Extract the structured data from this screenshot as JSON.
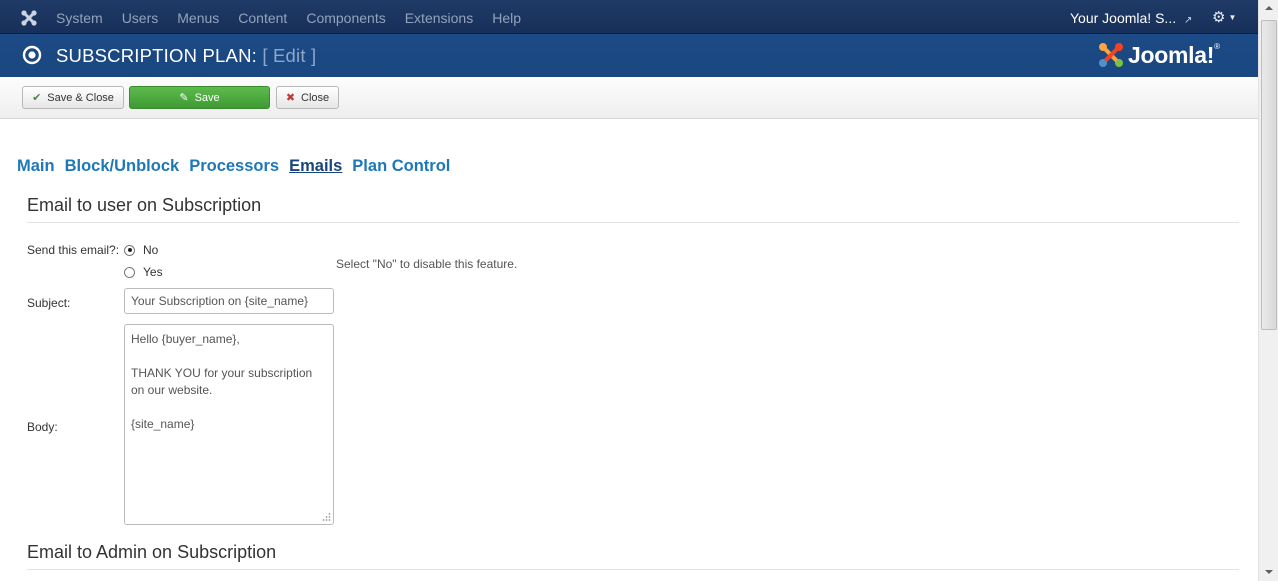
{
  "navbar": {
    "menu": [
      "System",
      "Users",
      "Menus",
      "Content",
      "Components",
      "Extensions",
      "Help"
    ],
    "site_link": "Your Joomla! S...",
    "icons": {
      "logo": "joomla-logo-icon",
      "external": "external-link-icon",
      "gear": "gear-icon"
    }
  },
  "header": {
    "title": "SUBSCRIPTION PLAN:",
    "subtitle": "[ Edit ]",
    "brand": "Joomla!",
    "brand_mark": "®"
  },
  "toolbar": {
    "save_close_label": "Save & Close",
    "save_label": "Save",
    "close_label": "Close"
  },
  "tabs": [
    {
      "label": "Main",
      "active": false
    },
    {
      "label": "Block/Unblock",
      "active": false
    },
    {
      "label": "Processors",
      "active": false
    },
    {
      "label": "Emails",
      "active": true
    },
    {
      "label": "Plan Control",
      "active": false
    }
  ],
  "user_email": {
    "title": "Email to user on Subscription",
    "send_label": "Send this email?:",
    "options": {
      "no": "No",
      "yes": "Yes"
    },
    "selected": "No",
    "hint": "Select \"No\" to disable this feature.",
    "subject_label": "Subject:",
    "subject_value": "Your Subscription on {site_name}",
    "body_label": "Body:",
    "body_lines": [
      "Hello {buyer_name},",
      "",
      "THANK YOU for your subscription",
      "on our website.",
      "",
      "{site_name}"
    ]
  },
  "admin_email": {
    "title": "Email to Admin on Subscription"
  },
  "colors": {
    "navbar_bg": "#1a345f",
    "header_bg": "#1b4983",
    "tab_link": "#1e78b8",
    "tab_active": "#18467a",
    "save_button": "#4aa83d"
  }
}
